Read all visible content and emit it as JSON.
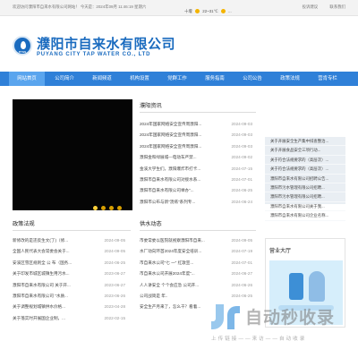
{
  "topbar": {
    "welcome": "欢迎访问濮阳市自来水有限公司网站！ 今天是：2024年09月 11:46:19 星期六",
    "links": [
      "投诉建议",
      "联系我们"
    ]
  },
  "weather": {
    "label": "十堰",
    "temp": "22~31℃",
    "trail": "..."
  },
  "logo": {
    "emblem_text": "PYGS",
    "name_cn": "濮阳市自来水有限公司",
    "name_en": "PUYANG CITY TAP WATER CO., LTD"
  },
  "nav": {
    "items": [
      "网站首页",
      "公司简介",
      "新闻频道",
      "机构设置",
      "党群工作",
      "服务指南",
      "公司公告",
      "政策法规",
      "营肯专栏"
    ],
    "active_index": 0
  },
  "news": {
    "title": "濮阳资讯",
    "items": [
      {
        "title": "2024年国家网络安全宣传周濮阳...",
        "date": "2024-09-03"
      },
      {
        "title": "2024年国家网络安全宣传周濮阳...",
        "date": "2024-09-03"
      },
      {
        "title": "2024年国家网络安全宣传周濮阳...",
        "date": "2024-09-03"
      },
      {
        "title": "濮阳金和绿展城—电动车严禁...",
        "date": "2024-09-02"
      },
      {
        "title": "金溪大学生们，濮阳爆炸市打卡...",
        "date": "2024-07-15"
      },
      {
        "title": "濮阳市自来水有限公司对接水系...",
        "date": "2024-07-01"
      },
      {
        "title": "濮阳市自来水有限公司举办\"...",
        "date": "2024-06-25"
      },
      {
        "title": "濮阳市公布与新\"溃疡\"系列专...",
        "date": "2024-06-24"
      }
    ]
  },
  "side_list": {
    "items": [
      "关于开展安全生产集中排查整治...",
      "关于开展食品安全三项行动...",
      "关于符合法规要求的（高层次）...",
      "关于符合法规要求的（高层次）...",
      "濮阳市自来水有限公司招聘公告...",
      "濮阳市污水管理有限公司招聘...",
      "濮阳市污水管理有限公司招聘...",
      "濮阳市自来水有限公司关于我...",
      "濮阳市自来水有限公司企业名称..."
    ]
  },
  "policy": {
    "title": "政策法规",
    "items": [
      {
        "title": "新修改的是违反生文(了)（修...",
        "date": "2024-09-05"
      },
      {
        "title": "全国人民代表大会常委会关于...",
        "date": "2024-09-05"
      },
      {
        "title": "安溪区雪区规则全 公 布（国务...",
        "date": "2024-06-25"
      },
      {
        "title": "关于印发市城区城镇生用污水...",
        "date": "2023-06-27"
      },
      {
        "title": "濮阳市自来水有限公司 关于开...",
        "date": "2023-06-27"
      },
      {
        "title": "濮阳市自来水有限公司 \"水质...",
        "date": "2023-06-26"
      },
      {
        "title": "关于调整规划城镇供水价格...",
        "date": "2023-04-28"
      },
      {
        "title": "关于落实时开展国企业制，...",
        "date": "2022-02-15"
      }
    ]
  },
  "supply": {
    "title": "供水动态",
    "items": [
      {
        "title": "市委常委以医院就视察濮阳市自来...",
        "date": "2024-09-05"
      },
      {
        "title": "水厂动向环首2024年度安全培训...",
        "date": "2024-07-19"
      },
      {
        "title": "市自来水公司\"七 一\" 红歌宣...",
        "date": "2024-07-01"
      },
      {
        "title": "市自来水公司开展2024年度\"...",
        "date": "2024-06-27"
      },
      {
        "title": "人人讲安全 个个会应急 公司开...",
        "date": "2024-06-26"
      },
      {
        "title": "公司战简是 年..",
        "date": "2024-06-25"
      },
      {
        "title": "安全生产月来了，怎么干？看着...",
        "date": ""
      },
      {
        "title": "",
        "date": ""
      }
    ]
  },
  "hall": {
    "title": "营业大厅"
  },
  "watermark": {
    "text": "自动秒收录",
    "sub": "上传链接——来访——自动收录"
  },
  "colors": {
    "brand": "#1a6bbf",
    "nav_bg": "#2f80d8",
    "nav_active": "#5aa5ee",
    "side_bg": "#e9eef3"
  }
}
